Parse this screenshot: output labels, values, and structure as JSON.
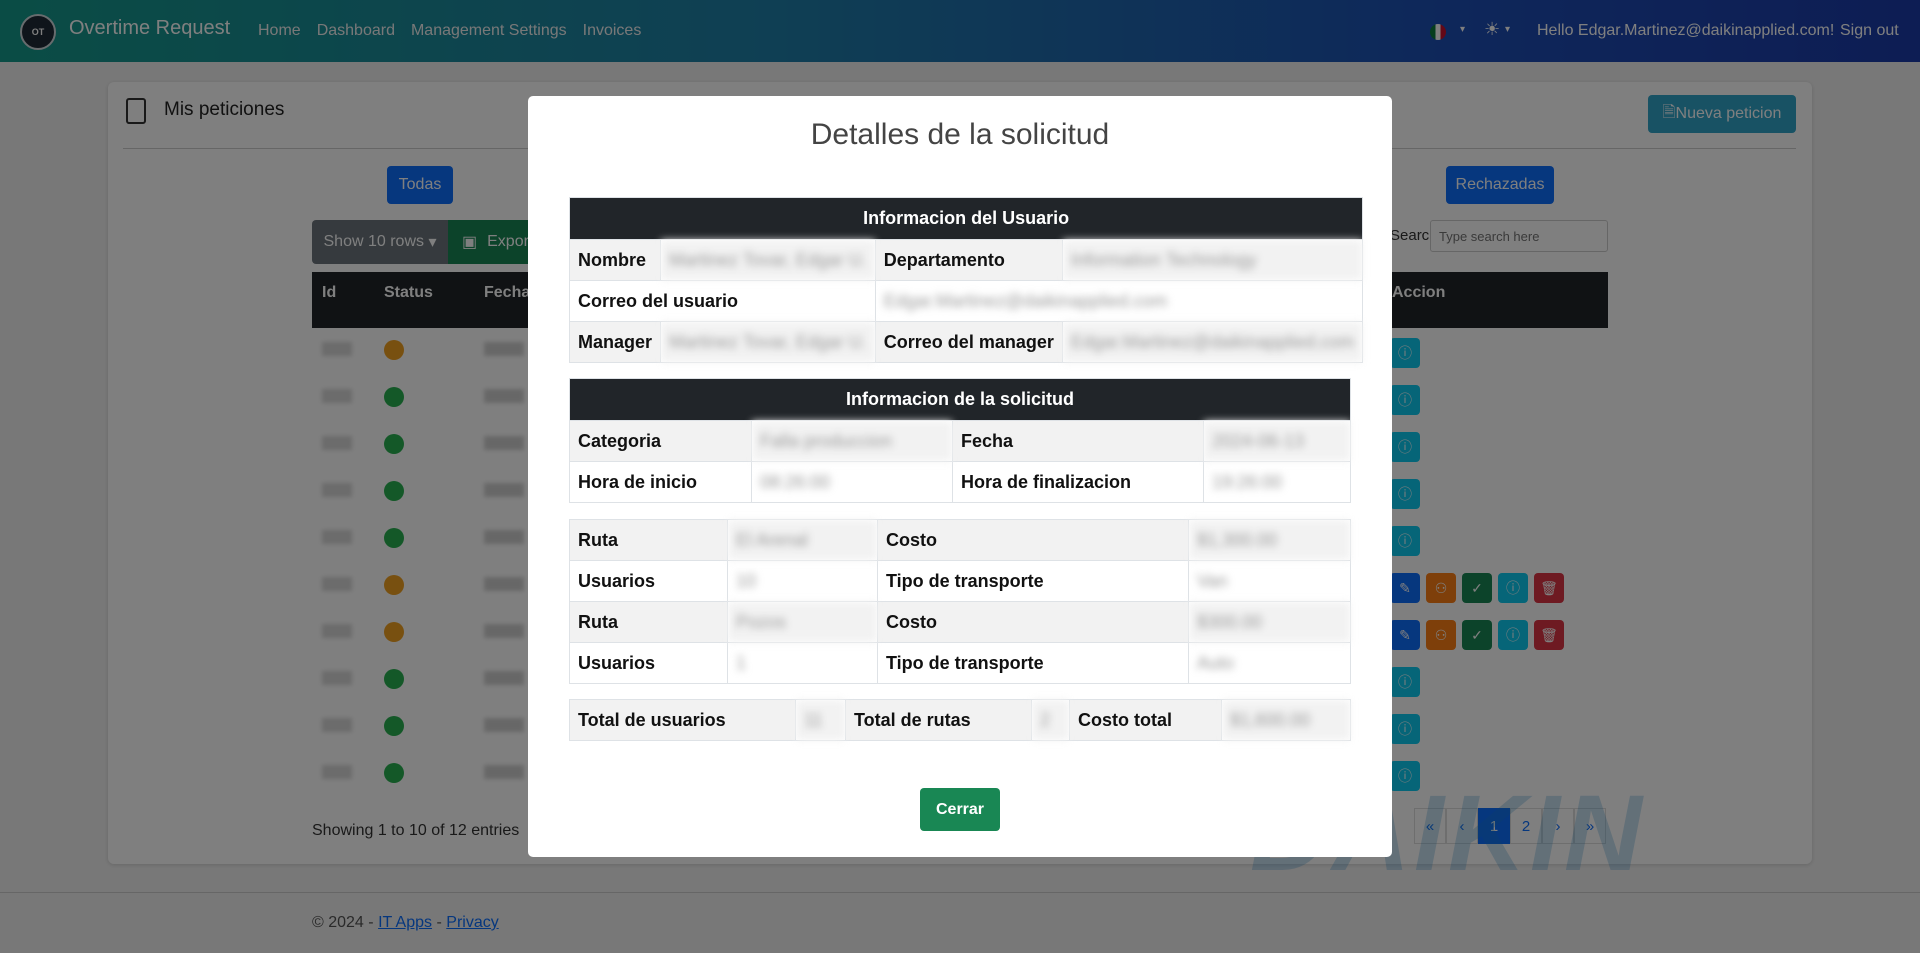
{
  "navbar": {
    "brand": "Overtime Request",
    "links": [
      "Home",
      "Dashboard",
      "Management Settings",
      "Invoices"
    ],
    "greeting": "Hello Edgar.Martinez@daikinapplied.com!",
    "signout": "Sign out",
    "logo_text": "OT"
  },
  "page": {
    "title": "Mis peticiones",
    "new_button": "Nueva peticion",
    "filter_all": "Todas",
    "filter_rejected": "Rechazadas",
    "show_rows": "Show 10 rows",
    "export": "Expor",
    "search_label": "Search:",
    "search_placeholder": "Type search here",
    "columns": [
      "Id",
      "Status",
      "Fecha",
      "Accion"
    ],
    "showing": "Showing 1 to 10 of 12 entries",
    "pager": [
      "«",
      "‹",
      "1",
      "2",
      "›",
      "»"
    ],
    "watermark": "DAIKIN"
  },
  "footer": {
    "copyright": "© 2024 -",
    "it_apps": "IT Apps",
    "sep": "-",
    "privacy": "Privacy"
  },
  "modal": {
    "title": "Detalles de la solicitud",
    "user_section": {
      "header": "Informacion del Usuario",
      "nombre_label": "Nombre",
      "nombre_value": "Martinez Tovar, Edgar U.",
      "departamento_label": "Departamento",
      "departamento_value": "Information Technology",
      "correo_label": "Correo del usuario",
      "correo_value": "Edgar.Martinez@daikinapplied.com",
      "manager_label": "Manager",
      "manager_value": "Martinez Tovar, Edgar U.",
      "correo_manager_label": "Correo del manager",
      "correo_manager_value": "Edgar.Martinez@daikinapplied.com"
    },
    "request_section": {
      "header": "Informacion de la solicitud",
      "categoria_label": "Categoria",
      "categoria_value": "Falla produccion",
      "fecha_label": "Fecha",
      "fecha_value": "2024-06-13",
      "inicio_label": "Hora de inicio",
      "inicio_value": "08:26:00",
      "fin_label": "Hora de finalizacion",
      "fin_value": "19:26:00"
    },
    "routes": [
      {
        "ruta_label": "Ruta",
        "ruta_value": "El Arenal",
        "costo_label": "Costo",
        "costo_value": "$1,300.00",
        "usuarios_label": "Usuarios",
        "usuarios_value": "10",
        "tipo_label": "Tipo de transporte",
        "tipo_value": "Van"
      },
      {
        "ruta_label": "Ruta",
        "ruta_value": "Pozos",
        "costo_label": "Costo",
        "costo_value": "$300.00",
        "usuarios_label": "Usuarios",
        "usuarios_value": "1",
        "tipo_label": "Tipo de transporte",
        "tipo_value": "Auto"
      }
    ],
    "totals": {
      "usuarios_label": "Total de usuarios",
      "usuarios_value": "11",
      "rutas_label": "Total de rutas",
      "rutas_value": "2",
      "costo_label": "Costo total",
      "costo_value": "$1,600.00"
    },
    "close_button": "Cerrar"
  }
}
